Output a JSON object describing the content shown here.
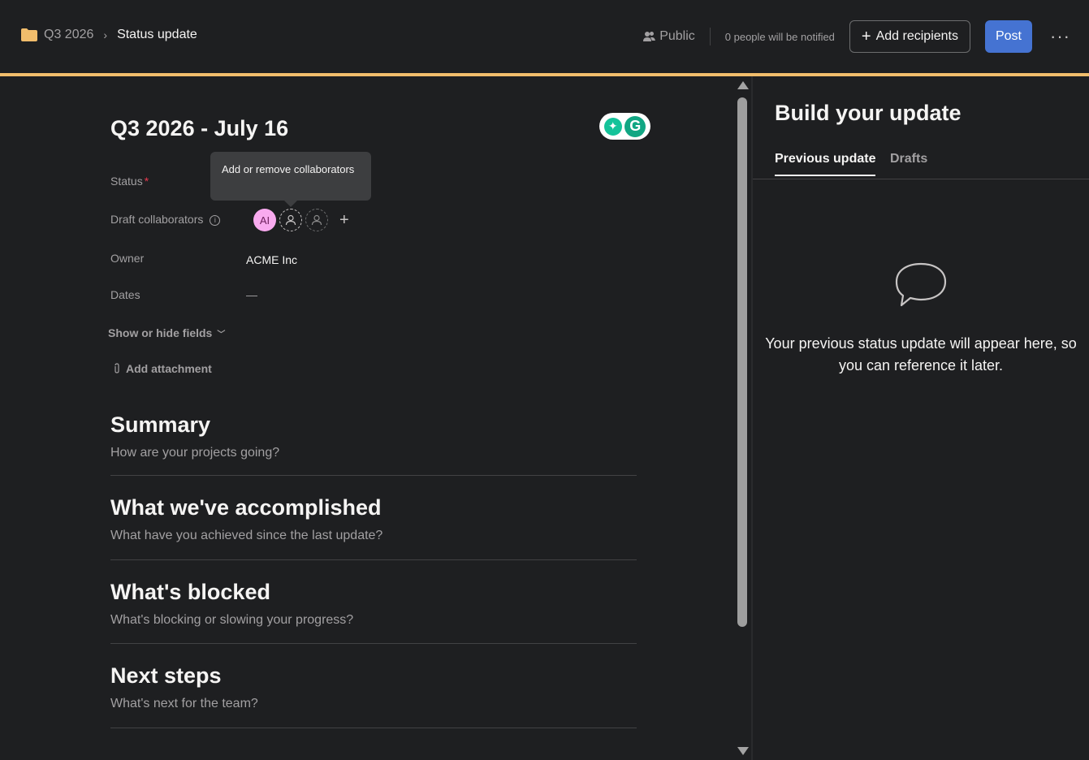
{
  "breadcrumb": {
    "parent": "Q3 2026",
    "current": "Status update"
  },
  "toolbar": {
    "visibility": "Public",
    "notify_text": "0 people will be notified",
    "add_recipients": "Add recipients",
    "post": "Post",
    "more": "···"
  },
  "doc": {
    "title": "Q3 2026 - July 16",
    "tooltip": "Add or remove collaborators",
    "fields": {
      "status_label": "Status",
      "required_mark": "*",
      "collaborators_label": "Draft collaborators",
      "collaborator_initials": "AI",
      "owner_label": "Owner",
      "owner_value": "ACME Inc",
      "dates_label": "Dates",
      "dates_value": "—"
    },
    "show_hide": "Show or hide fields",
    "add_attachment": "Add attachment",
    "sections": [
      {
        "heading": "Summary",
        "placeholder": "How are your projects going?"
      },
      {
        "heading": "What we've accomplished",
        "placeholder": "What have you achieved since the last update?"
      },
      {
        "heading": "What's blocked",
        "placeholder": "What's blocking or slowing your progress?"
      },
      {
        "heading": "Next steps",
        "placeholder": "What's next for the team?"
      }
    ]
  },
  "right_panel": {
    "title": "Build your update",
    "tabs": [
      "Previous update",
      "Drafts"
    ],
    "empty_message": "Your previous status update will appear here, so you can reference it later."
  },
  "colors": {
    "accent_line": "#f1bd6c",
    "post_button": "#4573d2",
    "avatar": "#f9aaef"
  }
}
